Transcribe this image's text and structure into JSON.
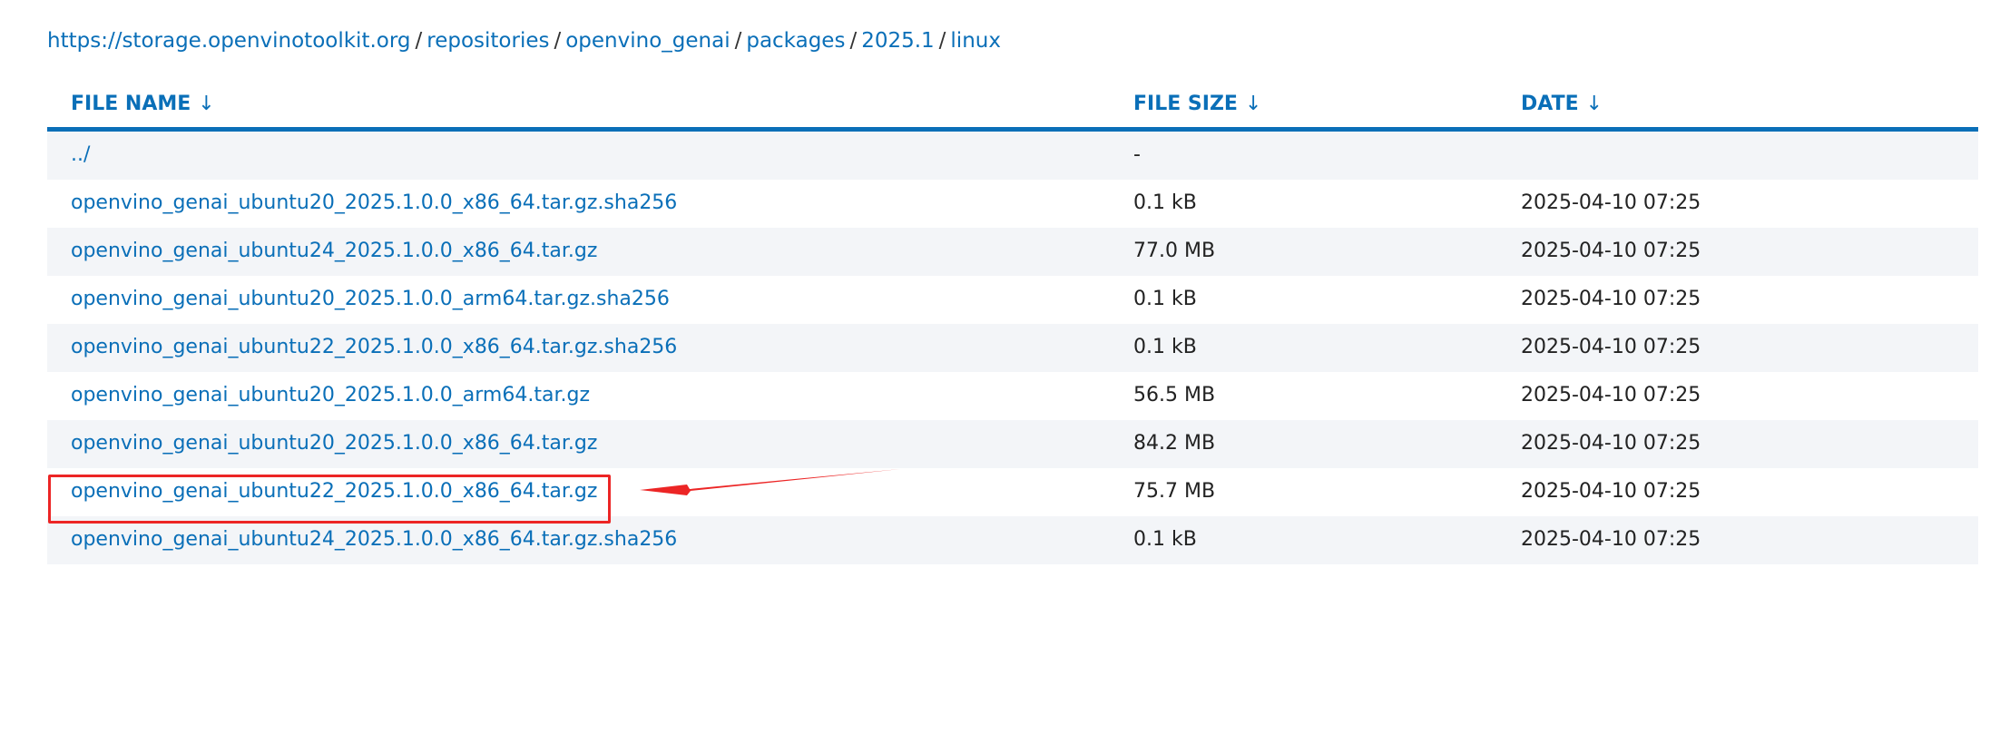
{
  "breadcrumb": {
    "items": [
      {
        "label": "https://storage.openvinotoolkit.org"
      },
      {
        "label": "repositories"
      },
      {
        "label": "openvino_genai"
      },
      {
        "label": "packages"
      },
      {
        "label": "2025.1"
      },
      {
        "label": "linux"
      }
    ],
    "separator": "/"
  },
  "table": {
    "headers": {
      "name": "FILE NAME",
      "size": "FILE SIZE",
      "date": "DATE",
      "sort_arrow": "↓"
    },
    "rows": [
      {
        "name": "../",
        "size": "-",
        "date": ""
      },
      {
        "name": "openvino_genai_ubuntu20_2025.1.0.0_x86_64.tar.gz.sha256",
        "size": "0.1 kB",
        "date": "2025-04-10 07:25"
      },
      {
        "name": "openvino_genai_ubuntu24_2025.1.0.0_x86_64.tar.gz",
        "size": "77.0 MB",
        "date": "2025-04-10 07:25"
      },
      {
        "name": "openvino_genai_ubuntu20_2025.1.0.0_arm64.tar.gz.sha256",
        "size": "0.1 kB",
        "date": "2025-04-10 07:25"
      },
      {
        "name": "openvino_genai_ubuntu22_2025.1.0.0_x86_64.tar.gz.sha256",
        "size": "0.1 kB",
        "date": "2025-04-10 07:25"
      },
      {
        "name": "openvino_genai_ubuntu20_2025.1.0.0_arm64.tar.gz",
        "size": "56.5 MB",
        "date": "2025-04-10 07:25"
      },
      {
        "name": "openvino_genai_ubuntu20_2025.1.0.0_x86_64.tar.gz",
        "size": "84.2 MB",
        "date": "2025-04-10 07:25"
      },
      {
        "name": "openvino_genai_ubuntu22_2025.1.0.0_x86_64.tar.gz",
        "size": "75.7 MB",
        "date": "2025-04-10 07:25"
      },
      {
        "name": "openvino_genai_ubuntu24_2025.1.0.0_x86_64.tar.gz.sha256",
        "size": "0.1 kB",
        "date": "2025-04-10 07:25"
      }
    ]
  },
  "colors": {
    "link": "#0a6fb8",
    "row_shade": "#f3f5f8",
    "annotation": "#ec2525"
  },
  "annotation": {
    "icon": "red-arrow-icon",
    "highlighted_row": 7
  }
}
